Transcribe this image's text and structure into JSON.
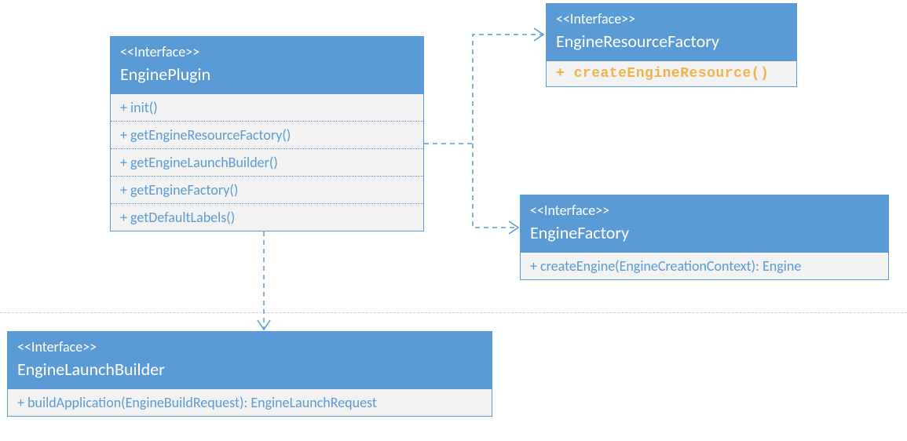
{
  "stereotype": "<<Interface>>",
  "enginePlugin": {
    "title": "EnginePlugin",
    "methods": [
      "+ init()",
      "+ getEngineResourceFactory()",
      "+ getEngineLaunchBuilder()",
      "+ getEngineFactory()",
      "+ getDefaultLabels()"
    ]
  },
  "engineResourceFactory": {
    "title": "EngineResourceFactory",
    "method": "+ createEngineResource()"
  },
  "engineFactory": {
    "title": "EngineFactory",
    "method": "+ createEngine(EngineCreationContext): Engine"
  },
  "engineLaunchBuilder": {
    "title": "EngineLaunchBuilder",
    "method": "+ buildApplication(EngineBuildRequest): EngineLaunchRequest"
  }
}
